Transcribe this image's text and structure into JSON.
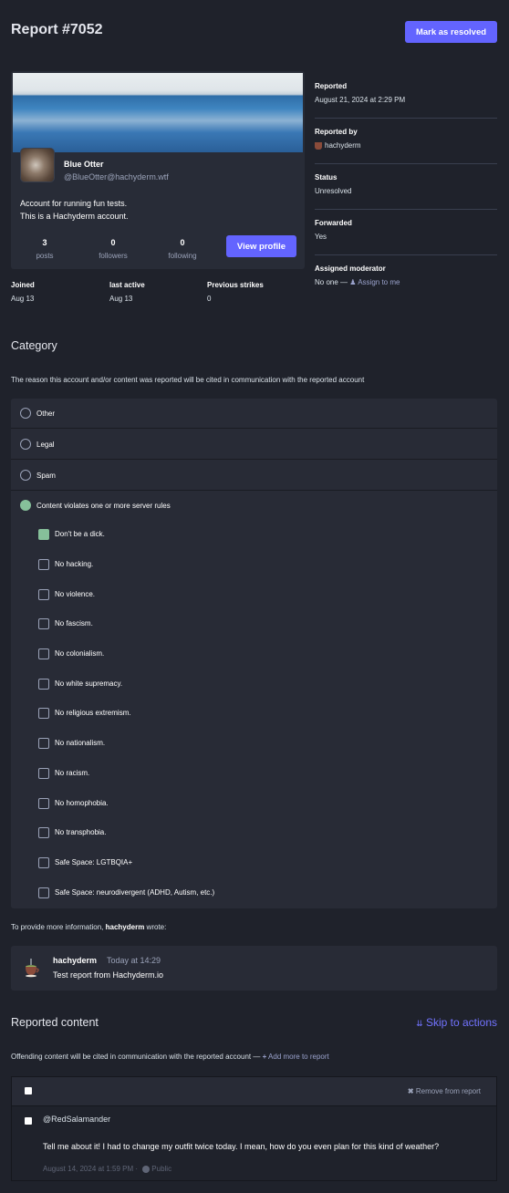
{
  "header": {
    "title": "Report #7052",
    "resolve_button": "Mark as resolved"
  },
  "account": {
    "display_name": "Blue Otter",
    "handle": "@BlueOtter@hachyderm.wtf",
    "bio_line1": "Account for running fun tests.",
    "bio_line2": "This is a Hachyderm account.",
    "stats": [
      {
        "value": "3",
        "label": "posts"
      },
      {
        "value": "0",
        "label": "followers"
      },
      {
        "value": "0",
        "label": "following"
      }
    ],
    "view_profile_button": "View profile",
    "meta": [
      {
        "label": "Joined",
        "value": "Aug 13"
      },
      {
        "label": "last active",
        "value": "Aug 13"
      },
      {
        "label": "Previous strikes",
        "value": "0"
      }
    ]
  },
  "report_info": {
    "reported_label": "Reported",
    "reported_value": "August 21, 2024 at 2:29 PM",
    "reported_by_label": "Reported by",
    "reported_by_value": "hachyderm",
    "status_label": "Status",
    "status_value": "Unresolved",
    "forwarded_label": "Forwarded",
    "forwarded_value": "Yes",
    "moderator_label": "Assigned moderator",
    "moderator_value": "No one —",
    "assign_link": "Assign to me"
  },
  "category": {
    "title": "Category",
    "hint": "The reason this account and/or content was reported will be cited in communication with the reported account",
    "options": [
      {
        "label": "Other",
        "selected": false
      },
      {
        "label": "Legal",
        "selected": false
      },
      {
        "label": "Spam",
        "selected": false
      },
      {
        "label": "Content violates one or more server rules",
        "selected": true
      }
    ],
    "rules": [
      {
        "label": "Don't be a dick.",
        "checked": true
      },
      {
        "label": "No hacking.",
        "checked": false
      },
      {
        "label": "No violence.",
        "checked": false
      },
      {
        "label": "No fascism.",
        "checked": false
      },
      {
        "label": "No colonialism.",
        "checked": false
      },
      {
        "label": "No white supremacy.",
        "checked": false
      },
      {
        "label": "No religious extremism.",
        "checked": false
      },
      {
        "label": "No nationalism.",
        "checked": false
      },
      {
        "label": "No racism.",
        "checked": false
      },
      {
        "label": "No homophobia.",
        "checked": false
      },
      {
        "label": "No transphobia.",
        "checked": false
      },
      {
        "label": "Safe Space: LGTBQIA+",
        "checked": false
      },
      {
        "label": "Safe Space: neurodivergent (ADHD, Autism, etc.)",
        "checked": false
      }
    ]
  },
  "comment": {
    "intro_prefix": "To provide more information,",
    "intro_author": "hachyderm",
    "intro_suffix": "wrote:",
    "author": "hachyderm",
    "time": "Today at 14:29",
    "text": "Test report from Hachyderm.io"
  },
  "reported_content": {
    "title": "Reported content",
    "skip_link": "Skip to actions",
    "hint": "Offending content will be cited in communication with the reported account —",
    "add_more_link": "Add more to report",
    "remove_link": "Remove from report",
    "status": {
      "account": "@RedSalamander",
      "text": "Tell me about it! I had to change my outfit twice today. I mean, how do you even plan for this kind of weather?",
      "date": "August 14, 2024 at 1:59 PM",
      "visibility": "Public"
    }
  },
  "colors": {
    "accent": "#6364ff",
    "selected": "#86c09a",
    "background": "#1f222b",
    "panel": "#282b36"
  }
}
